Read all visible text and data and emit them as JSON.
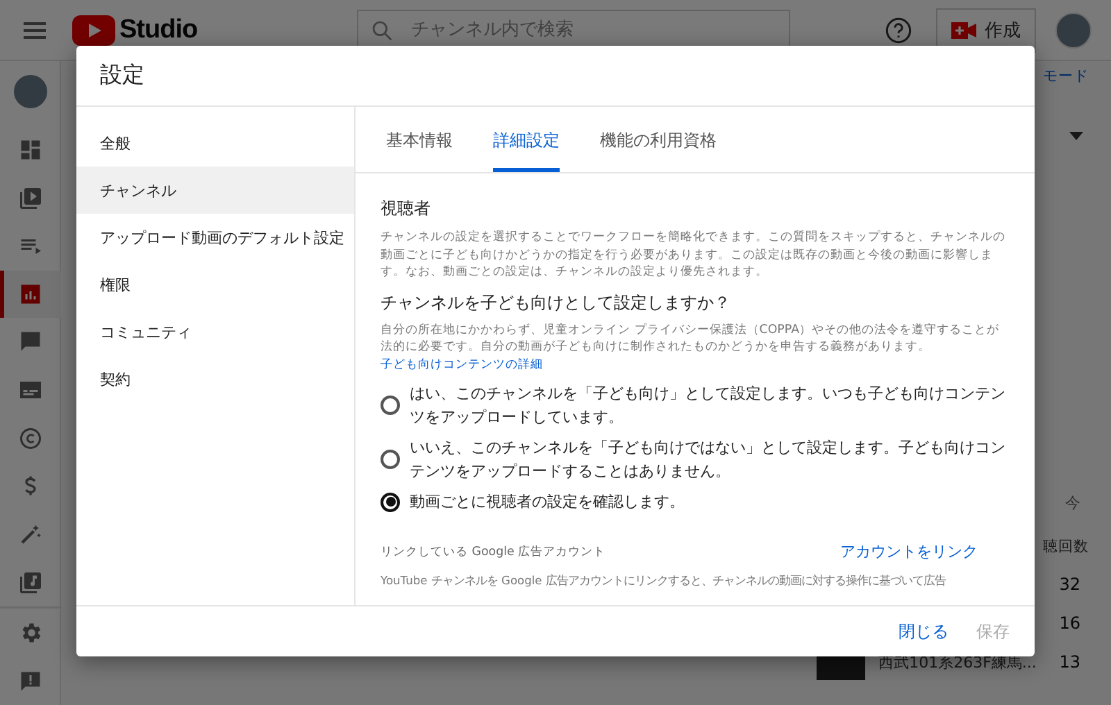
{
  "header": {
    "logo_text": "Studio",
    "search": {
      "placeholder": "チャンネル内で検索"
    },
    "create_button": "作成"
  },
  "rail": {
    "items": [
      {
        "kind": "dashboard",
        "selected": false
      },
      {
        "kind": "videos",
        "selected": false
      },
      {
        "kind": "playlists",
        "selected": false
      },
      {
        "kind": "analytics",
        "selected": true
      },
      {
        "kind": "comments",
        "selected": false
      },
      {
        "kind": "subtitles",
        "selected": false
      },
      {
        "kind": "copyright",
        "selected": false
      },
      {
        "kind": "earn",
        "selected": false
      },
      {
        "kind": "customize",
        "selected": false
      },
      {
        "kind": "audio",
        "selected": false
      }
    ],
    "bottom": [
      {
        "kind": "settings"
      },
      {
        "kind": "feedback"
      }
    ]
  },
  "background": {
    "mode_link": "モード",
    "time_label": "今",
    "views_heading": "聴回数",
    "rows": [
      {
        "title": "",
        "views": "32"
      },
      {
        "title": "",
        "views": "16"
      },
      {
        "title": "西武101系263F練馬...",
        "views": "13"
      }
    ]
  },
  "dialog": {
    "title": "設定",
    "nav": [
      {
        "label": "全般",
        "selected": false
      },
      {
        "label": "チャンネル",
        "selected": true
      },
      {
        "label": "アップロード動画のデフォルト設定",
        "selected": false
      },
      {
        "label": "権限",
        "selected": false
      },
      {
        "label": "コミュニティ",
        "selected": false
      },
      {
        "label": "契約",
        "selected": false
      }
    ],
    "tabs": [
      {
        "label": "基本情報",
        "selected": false
      },
      {
        "label": "詳細設定",
        "selected": true
      },
      {
        "label": "機能の利用資格",
        "selected": false
      }
    ],
    "audience": {
      "heading": "視聴者",
      "description": "チャンネルの設定を選択することでワークフローを簡略化できます。この質問をスキップすると、チャンネルの動画ごとに子ども向けかどうかの指定を行う必要があります。この設定は既存の動画と今後の動画に影響します。なお、動画ごとの設定は、チャンネルの設定より優先されます。",
      "question": "チャンネルを子ども向けとして設定しますか？",
      "legal_text": "自分の所在地にかかわらず、児童オンライン プライバシー保護法（COPPA）やその他の法令を遵守することが法的に必要です。自分の動画が子ども向けに制作されたものかどうかを申告する義務があります。",
      "legal_link": "子ども向けコンテンツの詳細",
      "options": [
        {
          "label": "はい、このチャンネルを「子ども向け」として設定します。いつも子ども向けコンテンツをアップロードしています。",
          "selected": false
        },
        {
          "label": "いいえ、このチャンネルを「子ども向けではない」として設定します。子ども向けコンテンツをアップロードすることはありません。",
          "selected": false
        },
        {
          "label": "動画ごとに視聴者の設定を確認します。",
          "selected": true
        }
      ]
    },
    "ads": {
      "label": "リンクしている Google 広告アカウント",
      "link_button": "アカウントをリンク",
      "description": "YouTube チャンネルを Google 広告アカウントにリンクすると、チャンネルの動画に対する操作に基づいて広告"
    },
    "footer": {
      "close_button": "閉じる",
      "save_button": "保存",
      "save_disabled": true
    }
  }
}
